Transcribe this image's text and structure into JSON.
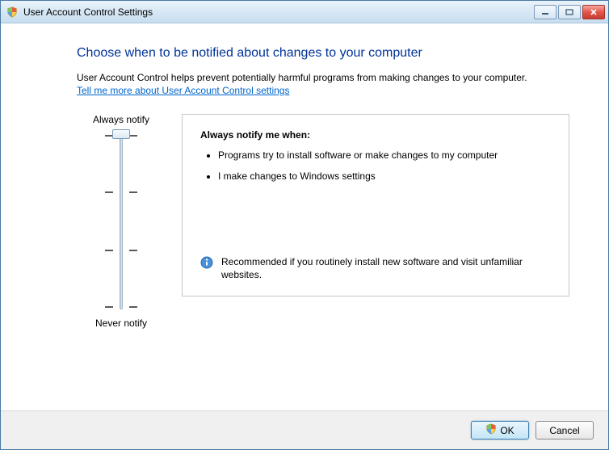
{
  "window": {
    "title": "User Account Control Settings"
  },
  "heading": "Choose when to be notified about changes to your computer",
  "intro": "User Account Control helps prevent potentially harmful programs from making changes to your computer.",
  "help_link": "Tell me more about User Account Control settings",
  "slider": {
    "top_label": "Always notify",
    "bottom_label": "Never notify"
  },
  "description": {
    "heading": "Always notify me when:",
    "bullets": [
      "Programs try to install software or make changes to my computer",
      "I make changes to Windows settings"
    ],
    "footer": "Recommended if you routinely install new software and visit unfamiliar websites."
  },
  "buttons": {
    "ok": "OK",
    "cancel": "Cancel"
  }
}
